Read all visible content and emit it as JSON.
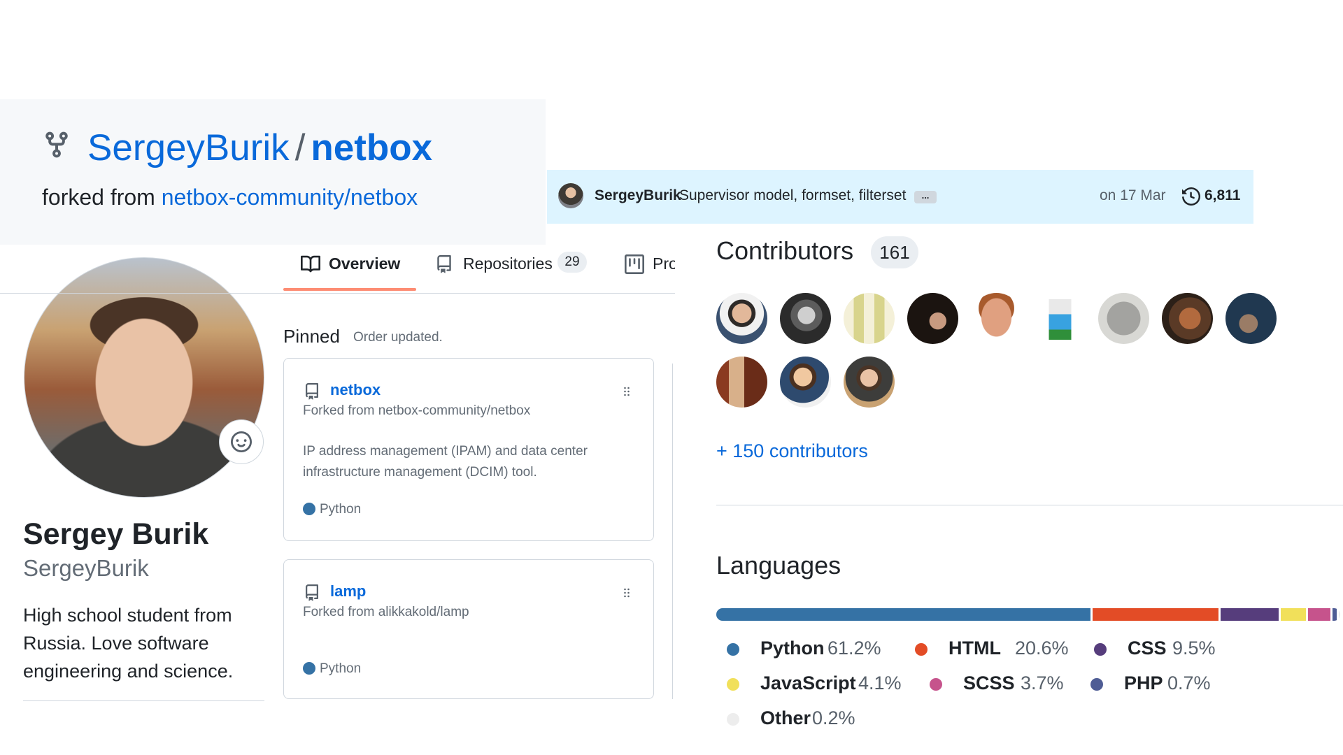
{
  "repo_header": {
    "owner": "SergeyBurik",
    "separator": "/",
    "name": "netbox",
    "forked_prefix": "forked from",
    "forked_source": "netbox-community/netbox"
  },
  "latest_commit": {
    "author": "SergeyBurik",
    "message": "Supervisor model, formset, filterset",
    "ellipsis": "...",
    "date": "on 17 Mar",
    "count": "6,811"
  },
  "profile": {
    "name": "Sergey Burik",
    "login": "SergeyBurik",
    "bio": "High school student from Russia. Love software engineering and science."
  },
  "tabs": {
    "overview": "Overview",
    "repositories": "Repositories",
    "repositories_count": "29",
    "projects": "Projects"
  },
  "pinned": {
    "heading": "Pinned",
    "subheading": "Order updated.",
    "items": [
      {
        "name": "netbox",
        "forked_from": "Forked from netbox-community/netbox",
        "description": "IP address management (IPAM) and data center infrastructure management (DCIM) tool.",
        "language": "Python",
        "language_color": "#3572A5"
      },
      {
        "name": "lamp",
        "forked_from": "Forked from alikkakold/lamp",
        "description": "",
        "language": "Python",
        "language_color": "#3572A5"
      }
    ]
  },
  "contributors": {
    "heading": "Contributors",
    "count": "161",
    "more_link": "+ 150 contributors"
  },
  "languages": {
    "heading": "Languages",
    "items": [
      {
        "name": "Python",
        "percent": "61.2%",
        "value": 61.2,
        "color": "#3572A5"
      },
      {
        "name": "HTML",
        "percent": "20.6%",
        "value": 20.6,
        "color": "#e34c26"
      },
      {
        "name": "CSS",
        "percent": "9.5%",
        "value": 9.5,
        "color": "#563d7c"
      },
      {
        "name": "JavaScript",
        "percent": "4.1%",
        "value": 4.1,
        "color": "#f1e05a"
      },
      {
        "name": "SCSS",
        "percent": "3.7%",
        "value": 3.7,
        "color": "#c6538c"
      },
      {
        "name": "PHP",
        "percent": "0.7%",
        "value": 0.7,
        "color": "#4F5D95"
      },
      {
        "name": "Other",
        "percent": "0.2%",
        "value": 0.2,
        "color": "#ededed"
      }
    ]
  },
  "icons": {
    "fork": "repo-forked-icon",
    "history": "history-icon",
    "book": "book-icon",
    "repo": "repo-icon",
    "project": "project-icon",
    "smiley": "smiley-icon",
    "drag": "grabber-icon"
  }
}
